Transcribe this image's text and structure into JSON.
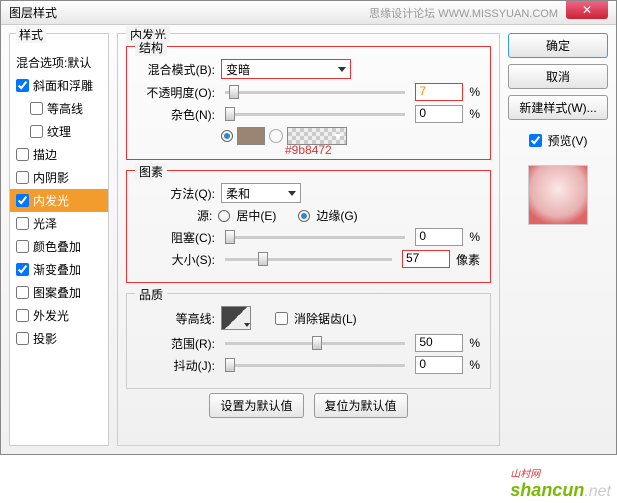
{
  "title": "图层样式",
  "subtitle": "思缘设计论坛  WWW.MISSYUAN.COM",
  "sidebar": {
    "header": "样式",
    "plain": "混合选项:默认",
    "items": [
      {
        "label": "斜面和浮雕",
        "checked": true
      },
      {
        "label": "等高线",
        "checked": false,
        "indent": true
      },
      {
        "label": "纹理",
        "checked": false,
        "indent": true
      },
      {
        "label": "描边",
        "checked": false
      },
      {
        "label": "内阴影",
        "checked": false
      },
      {
        "label": "内发光",
        "checked": true,
        "selected": true
      },
      {
        "label": "光泽",
        "checked": false
      },
      {
        "label": "颜色叠加",
        "checked": false
      },
      {
        "label": "渐变叠加",
        "checked": true
      },
      {
        "label": "图案叠加",
        "checked": false
      },
      {
        "label": "外发光",
        "checked": false
      },
      {
        "label": "投影",
        "checked": false
      }
    ]
  },
  "main": {
    "title": "内发光",
    "structure": {
      "title": "结构",
      "blend_label": "混合模式(B):",
      "blend_value": "变暗",
      "opacity_label": "不透明度(O):",
      "opacity_value": "7",
      "opacity_unit": "%",
      "noise_label": "杂色(N):",
      "noise_value": "0",
      "noise_unit": "%",
      "color_hex": "#9b8472"
    },
    "element": {
      "title": "图素",
      "method_label": "方法(Q):",
      "method_value": "柔和",
      "source_label": "源:",
      "center_label": "居中(E)",
      "edge_label": "边缘(G)",
      "choke_label": "阻塞(C):",
      "choke_value": "0",
      "choke_unit": "%",
      "size_label": "大小(S):",
      "size_value": "57",
      "size_unit": "像素"
    },
    "quality": {
      "title": "品质",
      "contour_label": "等高线:",
      "anti_label": "消除锯齿(L)",
      "range_label": "范围(R):",
      "range_value": "50",
      "range_unit": "%",
      "jitter_label": "抖动(J):",
      "jitter_value": "0",
      "jitter_unit": "%"
    },
    "buttons": {
      "default": "设置为默认值",
      "reset": "复位为默认值"
    }
  },
  "right": {
    "ok": "确定",
    "cancel": "取消",
    "newstyle": "新建样式(W)...",
    "preview": "预览(V)"
  },
  "watermark": {
    "main": "shancun",
    "sub": ".net",
    "cn": "山村网"
  }
}
